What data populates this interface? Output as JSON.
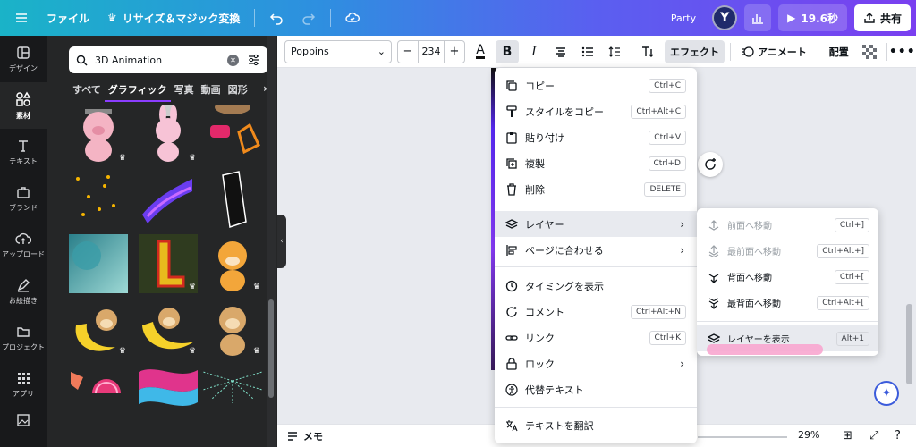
{
  "topbar": {
    "file": "ファイル",
    "resize": "リサイズ＆マジック変換",
    "team": "Party",
    "avatar": "Y",
    "play_time": "19.6秒",
    "share": "共有"
  },
  "rail": {
    "items": [
      {
        "label": "デザイン",
        "icon": "layout-icon"
      },
      {
        "label": "素材",
        "icon": "shapes-icon"
      },
      {
        "label": "テキスト",
        "icon": "text-icon"
      },
      {
        "label": "ブランド",
        "icon": "brand-icon"
      },
      {
        "label": "アップロード",
        "icon": "upload-icon"
      },
      {
        "label": "お絵描き",
        "icon": "draw-icon"
      },
      {
        "label": "プロジェクト",
        "icon": "folder-icon"
      },
      {
        "label": "アプリ",
        "icon": "apps-icon"
      }
    ]
  },
  "panel": {
    "search_value": "3D Animation",
    "tabs": [
      "すべて",
      "グラフィック",
      "写真",
      "動画",
      "図形"
    ]
  },
  "toolbar": {
    "font": "Poppins",
    "font_size": "234",
    "effects": "エフェクト",
    "animate": "アニメート",
    "position": "配置"
  },
  "context_menu": {
    "items": [
      {
        "label": "コピー",
        "shortcut": "Ctrl+C"
      },
      {
        "label": "スタイルをコピー",
        "shortcut": "Ctrl+Alt+C"
      },
      {
        "label": "貼り付け",
        "shortcut": "Ctrl+V"
      },
      {
        "label": "複製",
        "shortcut": "Ctrl+D"
      },
      {
        "label": "削除",
        "shortcut": "DELETE"
      },
      {
        "label": "レイヤー"
      },
      {
        "label": "ページに合わせる"
      },
      {
        "label": "タイミングを表示"
      },
      {
        "label": "コメント",
        "shortcut": "Ctrl+Alt+N"
      },
      {
        "label": "リンク",
        "shortcut": "Ctrl+K"
      },
      {
        "label": "ロック"
      },
      {
        "label": "代替テキスト"
      },
      {
        "label": "テキストを翻訳"
      }
    ]
  },
  "layer_submenu": {
    "items": [
      {
        "label": "前面へ移動",
        "shortcut": "Ctrl+]"
      },
      {
        "label": "最前面へ移動",
        "shortcut": "Ctrl+Alt+]"
      },
      {
        "label": "背面へ移動",
        "shortcut": "Ctrl+["
      },
      {
        "label": "最背面へ移動",
        "shortcut": "Ctrl+Alt+["
      },
      {
        "label": "レイヤーを表示",
        "shortcut": "Alt+1"
      }
    ]
  },
  "bottombar": {
    "memo": "メモ",
    "zoom": "29%"
  },
  "colors": {
    "accent": "#8b3dff",
    "rail_bg": "#18191b",
    "panel_bg": "#252627"
  }
}
